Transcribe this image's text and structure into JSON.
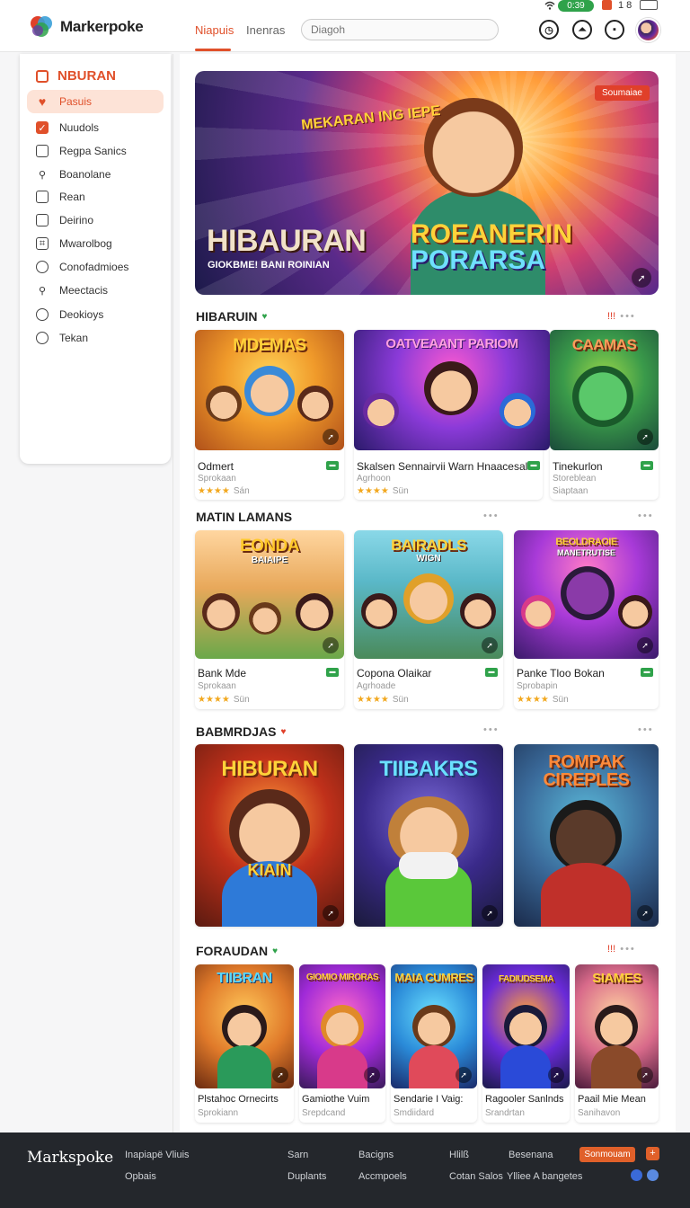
{
  "header": {
    "app_name": "Markerpoke",
    "tabs": [
      {
        "label": "Niapuis",
        "active": true
      },
      {
        "label": "Inenras",
        "active": false
      }
    ],
    "search_placeholder": "Diagoh",
    "status": {
      "pill": "0:39",
      "text": "1 8"
    },
    "icons": [
      "clock-icon",
      "user-icon",
      "bookmark-icon"
    ]
  },
  "sidebar": {
    "heading": "NBURAN",
    "items": [
      {
        "label": "Pasuis",
        "icon": "heart-icon",
        "active": true
      },
      {
        "label": "Nuudols",
        "icon": "tag-icon"
      },
      {
        "label": "Regpa Sanics",
        "icon": "square-icon"
      },
      {
        "label": "Boanolane",
        "icon": "person-icon"
      },
      {
        "label": "Rean",
        "icon": "square-icon"
      },
      {
        "label": "Deirino",
        "icon": "square-icon"
      },
      {
        "label": "Mwarolbog",
        "icon": "image-icon"
      },
      {
        "label": "Conofadmioes",
        "icon": "chat-icon"
      },
      {
        "label": "Meectacis",
        "icon": "person-icon"
      },
      {
        "label": "Deokioys",
        "icon": "chat-icon"
      },
      {
        "label": "Tekan",
        "icon": "group-icon"
      }
    ]
  },
  "hero": {
    "badge": "Soumaiae",
    "title": "HIBAURAN",
    "subtitle": "GIOKBME! BANI ROINIAN",
    "logo_text": "MEKARAN ING IEPE",
    "game_line1": "ROEANERIN",
    "game_line2": "PORARSA"
  },
  "sections": [
    {
      "title": "HIBARUIN",
      "mark": "♥",
      "more": "•••",
      "cards": [
        {
          "name": "Odmert",
          "sub": "Sprokaan",
          "rating": "★★★★",
          "rating_text": "Sán",
          "art_title": "MDEMAS"
        },
        {
          "name": "Skalsen Sennairvii Warn Hnaacesal",
          "sub": "Agrhoon",
          "rating": "★★★★",
          "rating_text": "Sün",
          "art_title": "OATVEAANT PARIOM"
        },
        {
          "name": "Tinekurlon",
          "sub": "Storeblean",
          "rating": "Siaptaan",
          "rating_text": "",
          "art_title": "CAAMAS"
        }
      ]
    },
    {
      "title": "MATIN LAMANS",
      "mark": "",
      "more": "•••",
      "cards": [
        {
          "name": "Bank Mde",
          "sub": "Sprokaan",
          "rating": "★★★★",
          "rating_text": "Sün",
          "art_title": "EONDA",
          "art_sub": "BAIAIPE"
        },
        {
          "name": "Copona Olaikar",
          "sub": "Agrhoade",
          "rating": "★★★★",
          "rating_text": "Sün",
          "art_title": "BAIRADLS",
          "art_sub": "WIGN"
        },
        {
          "name": "Panke Tloo Bokan",
          "sub": "Sprobapin",
          "rating": "★★★★",
          "rating_text": "Sün",
          "art_title": "BEOLDRAOIE",
          "art_sub": "MANETRUTISE"
        }
      ]
    },
    {
      "title": "BABMRDJAS",
      "mark": "♥",
      "more": "•••",
      "cards": [
        {
          "art_title": "HIBURAN",
          "art_sub": "KIAIN"
        },
        {
          "art_title": "TIIBAKRS"
        },
        {
          "art_title": "ROMPAK CIREPLES"
        }
      ]
    },
    {
      "title": "FORAUDAN",
      "mark": "♥",
      "more": "•••",
      "cards": [
        {
          "name": "Plstahoc Ornecirts",
          "sub": "Sprokiann",
          "art_title": "TIIBRAN"
        },
        {
          "name": "Gamiothe Vuim",
          "sub": "Srepdcand",
          "art_title": "GIOMIO MIRORAS"
        },
        {
          "name": "Sendarie I Vaig:",
          "sub": "Smdiidard",
          "art_title": "MAIA CUMRES"
        },
        {
          "name": "Ragooler Sanlnds",
          "sub": "Srandrtan",
          "art_title": "FADIUDSEMA"
        },
        {
          "name": "Paail Mie Mean",
          "sub": "Sanihavon",
          "art_title": "SIAMES"
        }
      ]
    }
  ],
  "footer": {
    "logo": "Markspoke",
    "links": [
      "Inapiapë Vliuis",
      "Opbais",
      "Sarn",
      "Duplants",
      "Bacigns",
      "Accmpoels",
      "Hlilß",
      "Cotan Salos",
      "Besenana",
      "Ylliee A bangetes"
    ],
    "button": "Sonmouam"
  },
  "colors": {
    "accent": "#e0502a",
    "success": "#2fa24a",
    "footer_bg": "#24272c"
  }
}
